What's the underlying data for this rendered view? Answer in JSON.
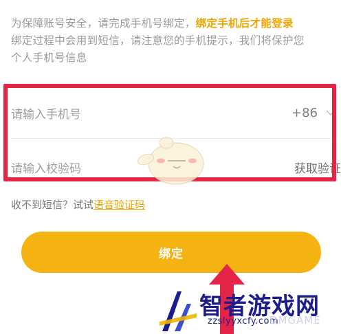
{
  "notice": {
    "text_plain": "为保障账号安全，请完成手机号绑定，",
    "text_highlight": "绑定手机后才能登录",
    "text_line2": "绑定过程中会用到短信，请注意您的手机提示，我们将保护您",
    "text_line3": "个人手机号信息"
  },
  "phone_field": {
    "placeholder": "请输入手机号",
    "country_code": "+86"
  },
  "code_field": {
    "placeholder": "请输入校验码",
    "get_code_label": "获取验证"
  },
  "voice": {
    "prompt": "收不到短信？试试",
    "link_label": "语音验证码"
  },
  "bind_button": {
    "label": "绑定"
  },
  "watermark": {
    "title": "智者游戏网",
    "url": "zzslyyxcfy.com",
    "faint": "DMGAME"
  },
  "colors": {
    "accent": "#f5b311",
    "highlight_text": "#f0a500",
    "annotation_red": "#e42547",
    "watermark_blue": "#1c1c8c"
  }
}
